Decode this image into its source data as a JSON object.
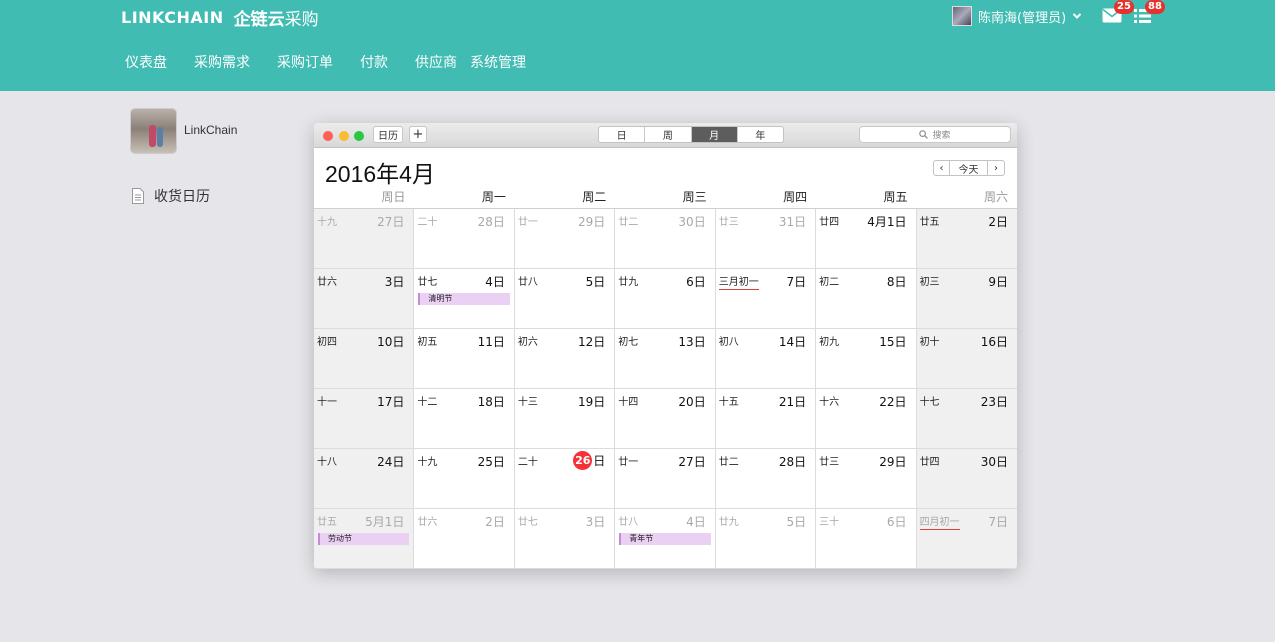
{
  "header": {
    "brand_en": "LINKCHAIN",
    "brand_cn_bold": "企链云",
    "brand_cn_rest": "采购",
    "nav": [
      "仪表盘",
      "采购需求",
      "采购订单",
      "付款",
      "供应商",
      "系统管理"
    ],
    "user_name": "陈南海(管理员)",
    "mail_badge": "25",
    "task_badge": "88",
    "color": "#40bcb3"
  },
  "sidebar": {
    "profile_name": "LinkChain",
    "menu_label": "收货日历"
  },
  "calendar": {
    "toolbar": {
      "calendars_label": "日历",
      "add_label": "+",
      "views": [
        "日",
        "周",
        "月",
        "年"
      ],
      "active_view": "月",
      "search_placeholder": "搜索",
      "today_label": "今天",
      "prev_label": "‹",
      "next_label": "›"
    },
    "title": "2016年4月",
    "weekdays": [
      "周日",
      "周一",
      "周二",
      "周三",
      "周四",
      "周五",
      "周六"
    ],
    "weeks": [
      [
        {
          "lunar": "十九",
          "day": "27日",
          "dim": true
        },
        {
          "lunar": "二十",
          "day": "28日",
          "dim": true
        },
        {
          "lunar": "廿一",
          "day": "29日",
          "dim": true
        },
        {
          "lunar": "廿二",
          "day": "30日",
          "dim": true
        },
        {
          "lunar": "廿三",
          "day": "31日",
          "dim": true
        },
        {
          "lunar": "廿四",
          "day": "4月1日"
        },
        {
          "lunar": "廿五",
          "day": "2日"
        }
      ],
      [
        {
          "lunar": "廿六",
          "day": "3日"
        },
        {
          "lunar": "廿七",
          "day": "4日",
          "event": "清明节"
        },
        {
          "lunar": "廿八",
          "day": "5日"
        },
        {
          "lunar": "廿九",
          "day": "6日"
        },
        {
          "lunar": "三月初一",
          "day": "7日",
          "festival": true
        },
        {
          "lunar": "初二",
          "day": "8日"
        },
        {
          "lunar": "初三",
          "day": "9日"
        }
      ],
      [
        {
          "lunar": "初四",
          "day": "10日"
        },
        {
          "lunar": "初五",
          "day": "11日"
        },
        {
          "lunar": "初六",
          "day": "12日"
        },
        {
          "lunar": "初七",
          "day": "13日"
        },
        {
          "lunar": "初八",
          "day": "14日"
        },
        {
          "lunar": "初九",
          "day": "15日"
        },
        {
          "lunar": "初十",
          "day": "16日"
        }
      ],
      [
        {
          "lunar": "十一",
          "day": "17日"
        },
        {
          "lunar": "十二",
          "day": "18日"
        },
        {
          "lunar": "十三",
          "day": "19日"
        },
        {
          "lunar": "十四",
          "day": "20日"
        },
        {
          "lunar": "十五",
          "day": "21日"
        },
        {
          "lunar": "十六",
          "day": "22日"
        },
        {
          "lunar": "十七",
          "day": "23日"
        }
      ],
      [
        {
          "lunar": "十八",
          "day": "24日"
        },
        {
          "lunar": "十九",
          "day": "25日"
        },
        {
          "lunar": "二十",
          "day": "日",
          "today": "26"
        },
        {
          "lunar": "廿一",
          "day": "27日"
        },
        {
          "lunar": "廿二",
          "day": "28日"
        },
        {
          "lunar": "廿三",
          "day": "29日"
        },
        {
          "lunar": "廿四",
          "day": "30日"
        }
      ],
      [
        {
          "lunar": "廿五",
          "day": "5月1日",
          "dim": true,
          "event": "劳动节"
        },
        {
          "lunar": "廿六",
          "day": "2日",
          "dim": true
        },
        {
          "lunar": "廿七",
          "day": "3日",
          "dim": true
        },
        {
          "lunar": "廿八",
          "day": "4日",
          "dim": true,
          "event": "青年节"
        },
        {
          "lunar": "廿九",
          "day": "5日",
          "dim": true
        },
        {
          "lunar": "三十",
          "day": "6日",
          "dim": true
        },
        {
          "lunar": "四月初一",
          "day": "7日",
          "dim": true,
          "festival": true
        }
      ]
    ]
  }
}
